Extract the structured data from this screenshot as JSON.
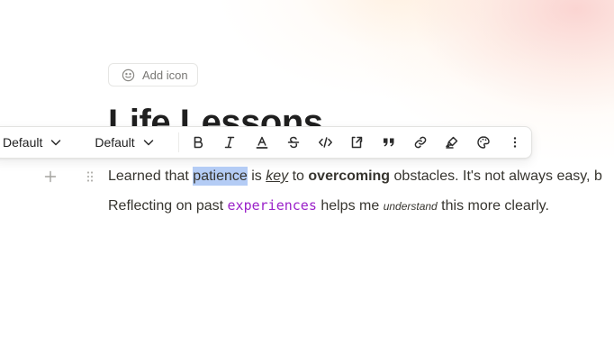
{
  "header": {
    "add_icon_label": "Add icon",
    "title": "Life Lessons"
  },
  "toolbar": {
    "block_type": "Default",
    "font_type": "Default",
    "buttons": [
      "bold",
      "italic",
      "text-color",
      "strikethrough",
      "code",
      "turn-into",
      "quote",
      "link",
      "highlight",
      "color",
      "more"
    ]
  },
  "content": {
    "paragraph1": {
      "t1": "Learned that ",
      "selected": "patience",
      "t2": " is ",
      "key": "key",
      "t3": " to ",
      "bold": "overcoming",
      "t4": " obstacles. It's not always easy, b"
    },
    "paragraph2": {
      "t1": "Reflecting on past ",
      "code": "experiences",
      "t2": " helps me ",
      "small": "understand",
      "t3": " this more clearly."
    }
  },
  "colors": {
    "selection": "#b4ccf5",
    "code_text": "#9b22c9",
    "text": "#37352f"
  }
}
